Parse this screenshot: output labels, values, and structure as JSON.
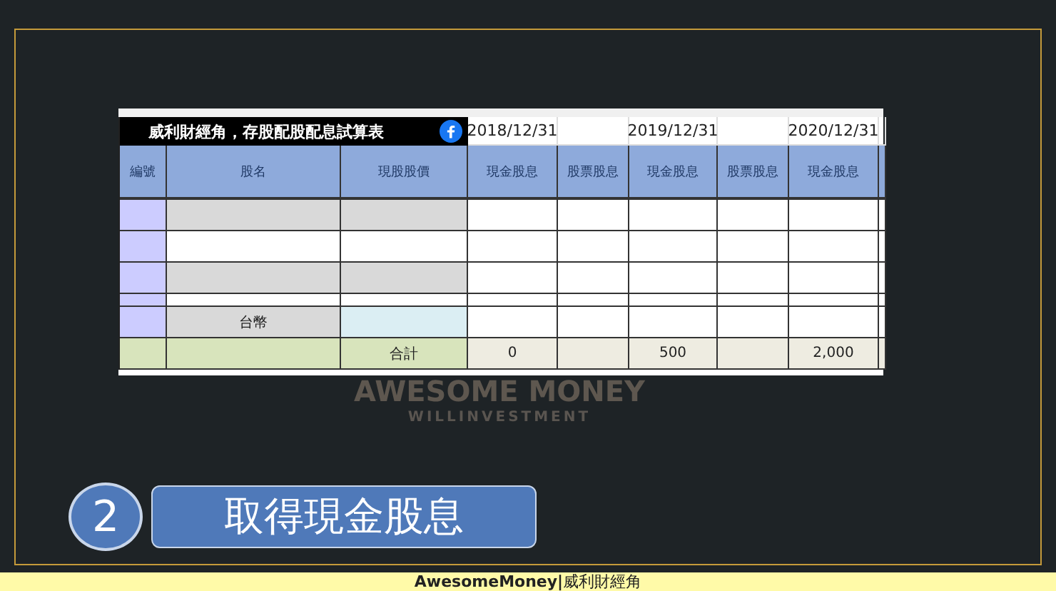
{
  "sheet": {
    "title": "威利財經角，存股配股配息試算表",
    "dates": [
      "2018/12/31",
      "2019/12/31",
      "2020/12/31"
    ],
    "headers": [
      "編號",
      "股名",
      "現股股價",
      "現金股息",
      "股票股息",
      "現金股息",
      "股票股息",
      "現金股息"
    ],
    "rows": [
      {
        "kind": "gray"
      },
      {
        "kind": "white"
      },
      {
        "kind": "gray"
      },
      {
        "kind": "thin"
      },
      {
        "kind": "currency",
        "name": "台幣"
      }
    ],
    "total": {
      "label": "合計",
      "cash_totals": [
        "0",
        "500",
        "2,000"
      ]
    }
  },
  "logo": {
    "name": "AWESOME MONEY",
    "tagline": "WILLINVESTMENT"
  },
  "step": {
    "number": "2",
    "label": "取得現金股息"
  },
  "footer": {
    "brand": "AwesomeMoney",
    "separator": "|",
    "name": "威利財經角"
  }
}
